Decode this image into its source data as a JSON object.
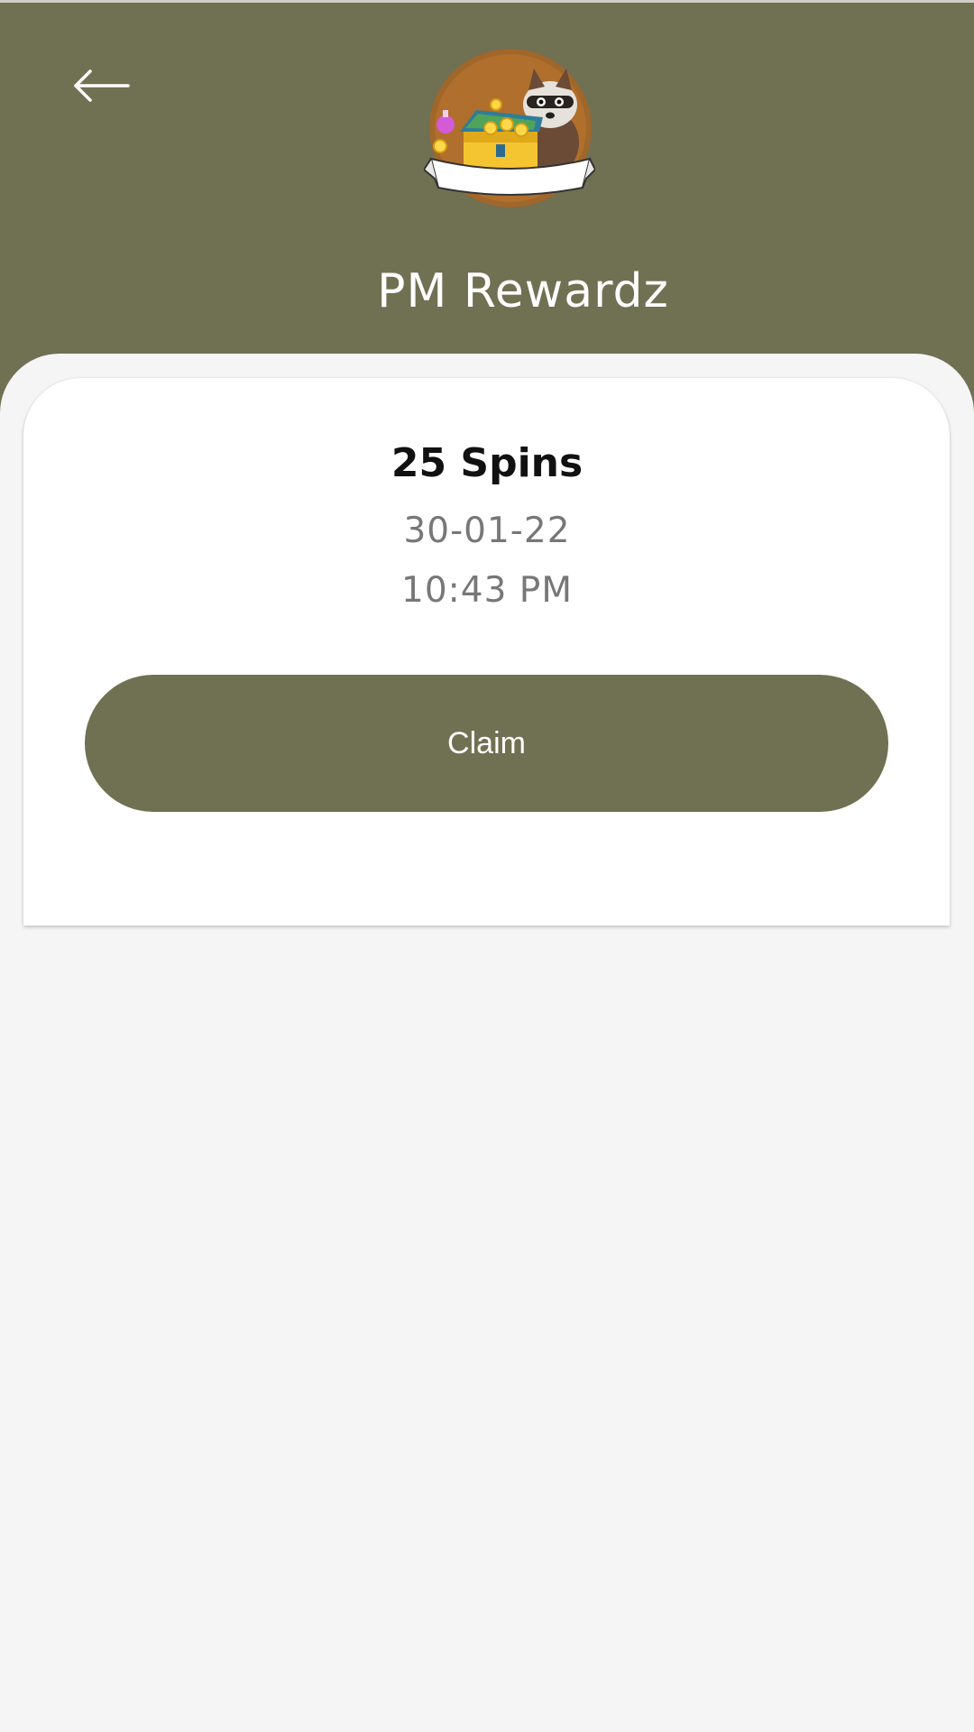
{
  "header": {
    "title": "PM Rewardz",
    "background_color": "#707053",
    "back_icon": "arrow-left-icon",
    "logo": "raccoon-treasure-chest-logo"
  },
  "reward": {
    "title": "25 Spins",
    "date": "30-01-22",
    "time": "10:43 PM"
  },
  "actions": {
    "claim_label": "Claim",
    "accent_color": "#707053"
  }
}
